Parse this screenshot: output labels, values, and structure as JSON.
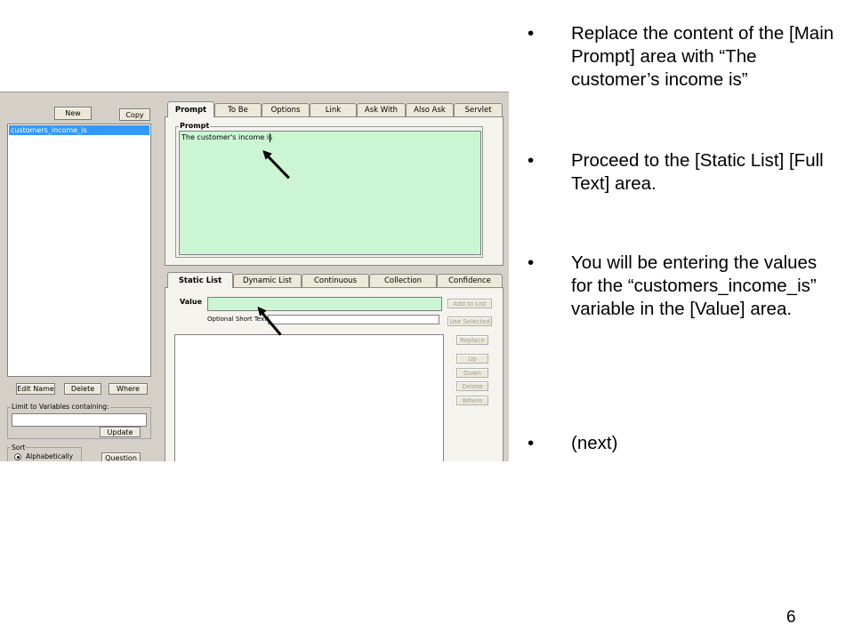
{
  "left_pane": {
    "new_button": "New",
    "copy_button": "Copy",
    "variables": [
      "customers_income_is"
    ],
    "edit_name_button": "Edit Name",
    "delete_button": "Delete",
    "where_button": "Where",
    "filter_label": "Limit to Variables containing:",
    "filter_value": "",
    "update_button": "Update",
    "sort_label": "Sort",
    "sort_option": "Alphabetically",
    "question_button": "Question"
  },
  "top_tabs": [
    "Prompt",
    "To Be",
    "Options",
    "Link",
    "Ask With",
    "Also Ask",
    "Servlet"
  ],
  "prompt_group_label": "Prompt",
  "prompt_text": "The customer's income is",
  "bottom_tabs": [
    "Static List",
    "Dynamic List",
    "Continuous",
    "Collection",
    "Confidence"
  ],
  "static_list": {
    "value_label": "Value",
    "value_text": "",
    "short_text_label": "Optional Short Text:",
    "short_text_value": "",
    "buttons": [
      "Add to List",
      "Use Selected",
      "Replace",
      "Up",
      "Down",
      "Delete",
      "Where"
    ]
  },
  "slide_bullets": [
    "Replace the content of the [Main Prompt] area with “The customer’s income is”",
    "Proceed to the [Static List] [Full Text] area.",
    "You will be entering the values for the “customers_income_is” variable in the [Value] area.",
    "(next)"
  ],
  "bullet_symbol": "•",
  "page_number": "6",
  "colors": {
    "prompt_bg": "#ccf5d4",
    "selection": "#3399ff",
    "dialog_bg": "#d4d0c8"
  }
}
